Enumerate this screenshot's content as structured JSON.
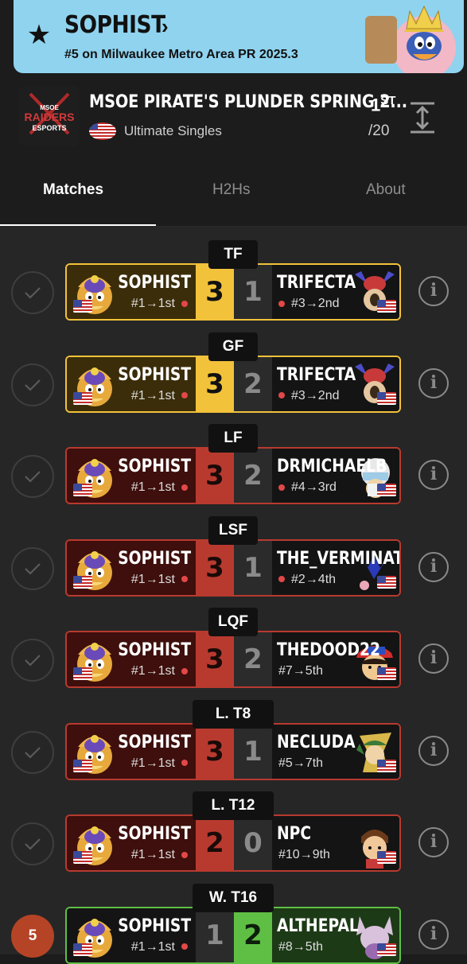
{
  "banner": {
    "title": "SOPHIST",
    "chevron": "›",
    "subtitle": "#5 on Milwaukee Metro Area PR 2025.3",
    "star_icon": "star-icon"
  },
  "tournament": {
    "name": "MSOE PIRATE'S PLUNDER SPRING 2...",
    "event": "Ultimate Singles",
    "placement": "1",
    "placement_suffix": "ST",
    "entrants": "/20"
  },
  "tabs": [
    {
      "label": "Matches",
      "active": true
    },
    {
      "label": "H2Hs",
      "active": false
    },
    {
      "label": "About",
      "active": false
    }
  ],
  "matches": [
    {
      "round": "TF",
      "style": "gold",
      "status": "check",
      "left": {
        "name": "SOPHIST",
        "seed": "#1→1st"
      },
      "score_l": "3",
      "score_r": "1",
      "right": {
        "name": "TRIFECTA",
        "seed": "#3→2nd",
        "dot": true
      }
    },
    {
      "round": "GF",
      "style": "gold",
      "status": "check",
      "left": {
        "name": "SOPHIST",
        "seed": "#1→1st"
      },
      "score_l": "3",
      "score_r": "2",
      "right": {
        "name": "TRIFECTA",
        "seed": "#3→2nd",
        "dot": true
      }
    },
    {
      "round": "LF",
      "style": "red",
      "status": "check",
      "left": {
        "name": "SOPHIST",
        "seed": "#1→1st"
      },
      "score_l": "3",
      "score_r": "2",
      "right": {
        "name": "DRMICHAELB",
        "seed": "#4→3rd",
        "dot": true
      }
    },
    {
      "round": "LSF",
      "style": "red",
      "status": "check",
      "left": {
        "name": "SOPHIST",
        "seed": "#1→1st"
      },
      "score_l": "3",
      "score_r": "1",
      "right": {
        "name": "THE_VERMINAT",
        "seed": "#2→4th",
        "dot": true
      }
    },
    {
      "round": "LQF",
      "style": "red",
      "status": "check",
      "left": {
        "name": "SOPHIST",
        "seed": "#1→1st"
      },
      "score_l": "3",
      "score_r": "2",
      "right": {
        "name": "THEDOOD22",
        "seed": "#7→5th",
        "dot": false
      }
    },
    {
      "round": "L. T8",
      "style": "red",
      "status": "check",
      "left": {
        "name": "SOPHIST",
        "seed": "#1→1st"
      },
      "score_l": "3",
      "score_r": "1",
      "right": {
        "name": "NECLUDA",
        "seed": "#5→7th",
        "dot": false
      }
    },
    {
      "round": "L. T12",
      "style": "red",
      "status": "check",
      "left": {
        "name": "SOPHIST",
        "seed": "#1→1st"
      },
      "score_l": "2",
      "score_r": "0",
      "right": {
        "name": "NPC",
        "seed": "#10→9th",
        "dot": false
      }
    },
    {
      "round": "W. T16",
      "style": "green",
      "status": "5",
      "left": {
        "name": "SOPHIST",
        "seed": "#1→1st"
      },
      "score_l": "1",
      "score_r": "2",
      "right": {
        "name": "ALTHEPAL",
        "seed": "#8→5th",
        "dot": false
      }
    }
  ],
  "colors": {
    "banner": "#8fd3ef",
    "gold": "#f2c23a",
    "red": "#b83a2f",
    "green": "#5fbf45",
    "seed_dot": "#e24848"
  }
}
